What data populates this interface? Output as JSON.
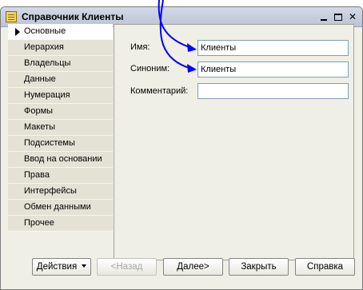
{
  "window": {
    "title": "Справочник Клиенты",
    "icon": "catalog-icon"
  },
  "nav": {
    "items": [
      {
        "label": "Основные",
        "active": true
      },
      {
        "label": "Иерархия"
      },
      {
        "label": "Владельцы"
      },
      {
        "label": "Данные"
      },
      {
        "label": "Нумерация"
      },
      {
        "label": "Формы"
      },
      {
        "label": "Макеты"
      },
      {
        "label": "Подсистемы"
      },
      {
        "label": "Ввод на основании"
      },
      {
        "label": "Права"
      },
      {
        "label": "Интерфейсы"
      },
      {
        "label": "Обмен данными"
      },
      {
        "label": "Прочее"
      }
    ]
  },
  "form": {
    "name_label": "Имя:",
    "name_value": "Клиенты",
    "synonym_label": "Синоним:",
    "synonym_value": "Клиенты",
    "comment_label": "Комментарий:",
    "comment_value": ""
  },
  "footer": {
    "actions": "Действия",
    "back": "<Назад",
    "next": "Далее>",
    "close": "Закрыть",
    "help": "Справка"
  },
  "colors": {
    "annotation_arrow": "#0000ff",
    "window_bg": "#f0efe6",
    "field_border": "#7f9db9"
  }
}
